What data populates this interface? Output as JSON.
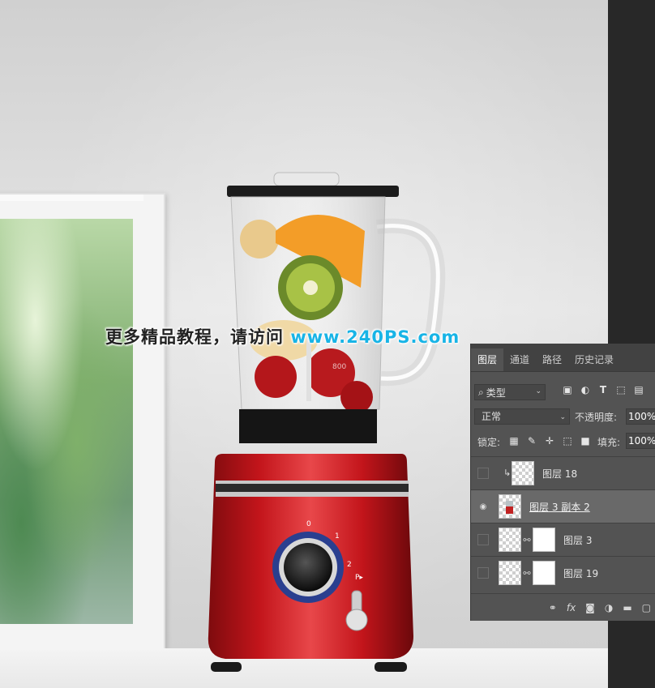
{
  "watermark": {
    "cn": "更多精品教程，请访问 ",
    "url": "www.240PS.com"
  },
  "panel": {
    "tabs": [
      "图层",
      "通道",
      "路径",
      "历史记录"
    ],
    "filter_label": "类型",
    "blend_mode": "正常",
    "opacity_label": "不透明度:",
    "opacity_value": "100%",
    "lock_label": "锁定:",
    "fill_label": "填充:",
    "fill_value": "100%",
    "layers": [
      {
        "name": "图层 18",
        "visible": false,
        "clipped": true,
        "selected": false
      },
      {
        "name": "图层 3 副本 2",
        "visible": true,
        "clipped": false,
        "selected": true
      },
      {
        "name": "图层 3",
        "visible": false,
        "clipped": false,
        "selected": false,
        "has_mask": true
      },
      {
        "name": "图层 19",
        "visible": false,
        "clipped": false,
        "selected": false,
        "has_mask": true
      }
    ],
    "filter_icons": [
      "image-filter-icon",
      "adjustment-filter-icon",
      "type-filter-icon",
      "shape-filter-icon",
      "smart-object-filter-icon"
    ],
    "lock_icons": [
      "lock-transparent-icon",
      "lock-brush-icon",
      "lock-move-icon",
      "lock-artboard-icon",
      "lock-all-icon"
    ],
    "footer_icons": [
      "link-layers-icon",
      "fx-icon",
      "add-mask-icon",
      "new-adjustment-icon",
      "new-group-icon",
      "new-layer-icon"
    ]
  },
  "blender": {
    "dial_labels": [
      "0",
      "1",
      "2",
      "P▸"
    ],
    "jar_marking": "800",
    "colors": {
      "base": "#c3151b",
      "base_highlight": "#e8474a",
      "dial_ring": "#2a3f8f"
    }
  }
}
